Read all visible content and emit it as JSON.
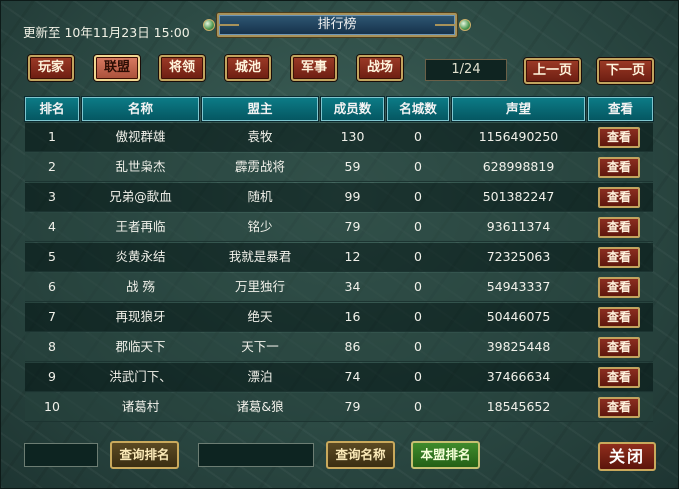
{
  "header": {
    "updated_text": "更新至 10年11月23日 15:00",
    "title": "排行榜"
  },
  "tabs": [
    {
      "label": "玩家",
      "active": false
    },
    {
      "label": "联盟",
      "active": true
    },
    {
      "label": "将领",
      "active": false
    },
    {
      "label": "城池",
      "active": false
    },
    {
      "label": "军事",
      "active": false
    },
    {
      "label": "战场",
      "active": false
    }
  ],
  "pagination": {
    "page_indicator": "1/24",
    "prev_label": "上一页",
    "next_label": "下一页"
  },
  "table": {
    "columns": [
      "排名",
      "名称",
      "盟主",
      "成员数",
      "名城数",
      "声望",
      "查看"
    ],
    "view_label": "查看",
    "rows": [
      {
        "rank": "1",
        "name": "傲视群雄",
        "leader": "袁牧",
        "members": "130",
        "cities": "0",
        "prestige": "1156490250"
      },
      {
        "rank": "2",
        "name": "乱世枭杰",
        "leader": "霹雳战将",
        "members": "59",
        "cities": "0",
        "prestige": "628998819"
      },
      {
        "rank": "3",
        "name": "兄弟@歃血",
        "leader": "随机",
        "members": "99",
        "cities": "0",
        "prestige": "501382247"
      },
      {
        "rank": "4",
        "name": "王者再临",
        "leader": "铭少",
        "members": "79",
        "cities": "0",
        "prestige": "93611374"
      },
      {
        "rank": "5",
        "name": "炎黄永结",
        "leader": "我就是暴君",
        "members": "12",
        "cities": "0",
        "prestige": "72325063"
      },
      {
        "rank": "6",
        "name": "战 殇",
        "leader": "万里独行",
        "members": "34",
        "cities": "0",
        "prestige": "54943337"
      },
      {
        "rank": "7",
        "name": "再现狼牙",
        "leader": "绝天",
        "members": "16",
        "cities": "0",
        "prestige": "50446075"
      },
      {
        "rank": "8",
        "name": "郡临天下",
        "leader": "天下一",
        "members": "86",
        "cities": "0",
        "prestige": "39825448"
      },
      {
        "rank": "9",
        "name": "洪武门下、",
        "leader": "漂泊",
        "members": "74",
        "cities": "0",
        "prestige": "37466634"
      },
      {
        "rank": "10",
        "name": "诸葛村",
        "leader": "诸葛&狼",
        "members": "79",
        "cities": "0",
        "prestige": "18545652"
      }
    ]
  },
  "footer": {
    "rank_input_value": "",
    "query_rank_label": "查询排名",
    "name_input_value": "",
    "query_name_label": "查询名称",
    "own_alliance_label": "本盟排名",
    "close_label": "关闭"
  },
  "colors": {
    "background": "#2c4a44",
    "header_teal": "#0c7b86",
    "button_red": "#8b2d20",
    "button_green": "#3f8b2c",
    "border_gold": "#c2a45e"
  }
}
